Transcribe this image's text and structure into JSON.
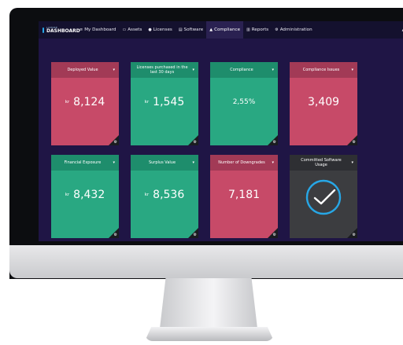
{
  "nav": {
    "logo_small": "LICENSE",
    "logo_big": "DASHBOARD",
    "items": [
      {
        "icon": "≡",
        "label": "My Dashboard"
      },
      {
        "icon": "▭",
        "label": "Assets"
      },
      {
        "icon": "●",
        "label": "Licenses"
      },
      {
        "icon": "▤",
        "label": "Software"
      },
      {
        "icon": "▲",
        "label": "Compliance"
      },
      {
        "icon": "▥",
        "label": "Reports"
      },
      {
        "icon": "⚙",
        "label": "Administration"
      }
    ],
    "active": "Compliance",
    "user_icon": "▲",
    "user_caret": "▾"
  },
  "tiles": [
    {
      "title": "Deployed Value",
      "currency": "kr",
      "value": "8,124",
      "color": "red"
    },
    {
      "title": "Licenses purchased in the last 30 days",
      "currency": "kr",
      "value": "1,545",
      "color": "green"
    },
    {
      "title": "Compliance",
      "currency": "",
      "value": "2,55%",
      "color": "green"
    },
    {
      "title": "Compliance Issues",
      "currency": "",
      "value": "3,409",
      "color": "red"
    },
    {
      "title": "Financial Exposure",
      "currency": "kr",
      "value": "8,432",
      "color": "green"
    },
    {
      "title": "Surplus Value",
      "currency": "kr",
      "value": "8,536",
      "color": "green"
    },
    {
      "title": "Number of Downgrades",
      "currency": "",
      "value": "7,181",
      "color": "red"
    },
    {
      "title": "Committed Software Usage",
      "currency": "",
      "value": "",
      "color": "dark"
    }
  ],
  "caret": "▾",
  "corner_icon": "⚙",
  "colors": {
    "red": "#c74a68",
    "green": "#29a882",
    "dark": "#3c3d40",
    "screen_bg": "#1f1545",
    "nav_bg": "#14112e",
    "check": "#27a7e6"
  }
}
